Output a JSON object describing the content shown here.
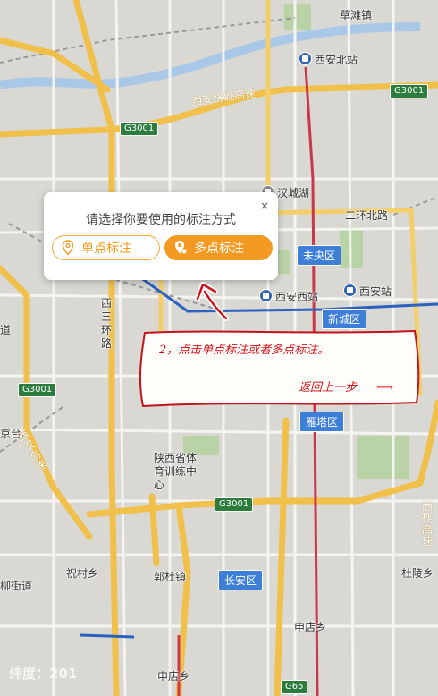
{
  "popup": {
    "title": "请选择你要使用的标注方式",
    "close": "×",
    "single_label": "单点标注",
    "multi_label": "多点标注"
  },
  "annotation": {
    "step_text": "2，点击单点标注或者多点标注。",
    "back_text": "返回上一步"
  },
  "coordinate_readout": "纬度：201",
  "map_labels": {
    "caotan_town": "草滩镇",
    "xian_north_station": "西安北站",
    "ring_expressway": "西安绕城高速",
    "hancheng_lake": "汉城湖",
    "second_ring_north": "二环北路",
    "weiyang_district": "未央区",
    "xian_west_station": "西安西站",
    "xian_station": "西安站",
    "xincheng_district": "新城区",
    "west_third_ring": "西三环路",
    "yanta_district": "雁塔区",
    "sports_center": "陕西省体育训练中心",
    "zhucun": "祝村乡",
    "guodu_town": "郭杜镇",
    "changan_district": "长安区",
    "shendian_1": "申店乡",
    "shendian_2": "申店乡",
    "duling": "杜陵乡",
    "liuxiang_street": "柳街道",
    "jingcheng": "京台",
    "dao": "道",
    "left_expressway": "西汉高速",
    "right_expressway": "西柞高速"
  },
  "road_shields": {
    "g3001_a": "G3001",
    "g3001_b": "G3001",
    "g3001_c": "G3001",
    "g3001_d": "G3001",
    "g65": "G65"
  },
  "colors": {
    "accent_orange": "#f49a22",
    "district_blue": "#3d7fd6",
    "annotation_red": "#d0141c",
    "shield_green": "#2b7c3d"
  }
}
